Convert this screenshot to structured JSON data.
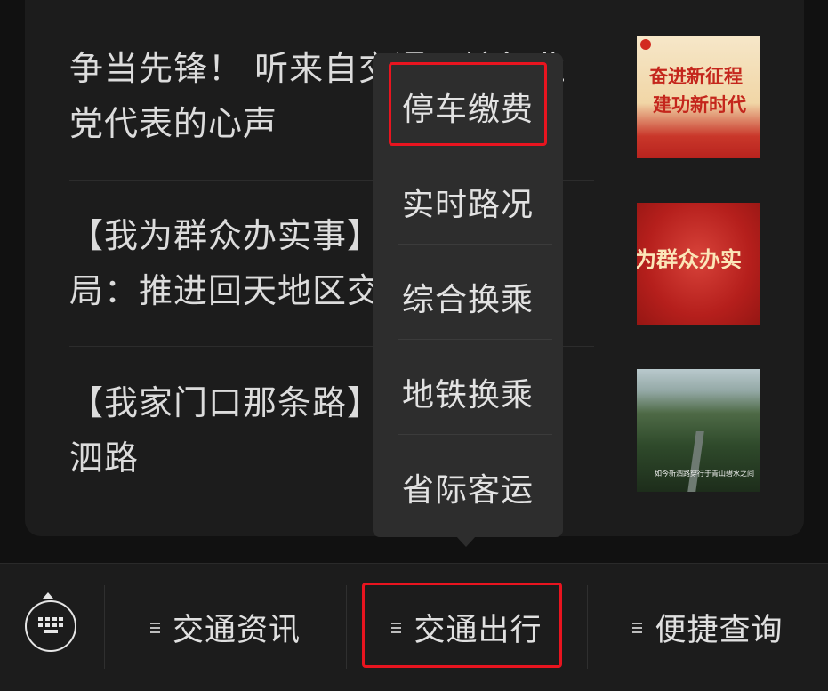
{
  "articles": [
    {
      "title": "争当先锋！ 听来自交通运输行业\n党代表的心声",
      "thumb_caption_1": "奋进新征程",
      "thumb_caption_2": "建功新时代"
    },
    {
      "title": "【我为群众办实事】\n局：推进回天地区交通",
      "thumb_caption": "为群众办实"
    },
    {
      "title": "【我家门口那条路】\n泗路",
      "thumb_caption": "如今新泗路穿行于青山碧水之间"
    }
  ],
  "popup_menu": {
    "items": [
      "停车缴费",
      "实时路况",
      "综合换乘",
      "地铁换乘",
      "省际客运"
    ]
  },
  "tabbar": {
    "keyboard_icon": "keyboard-icon",
    "tabs": [
      "交通资讯",
      "交通出行",
      "便捷查询"
    ]
  },
  "colors": {
    "highlight": "#e8141f",
    "background": "#111111",
    "popup": "#2d2d2d"
  }
}
